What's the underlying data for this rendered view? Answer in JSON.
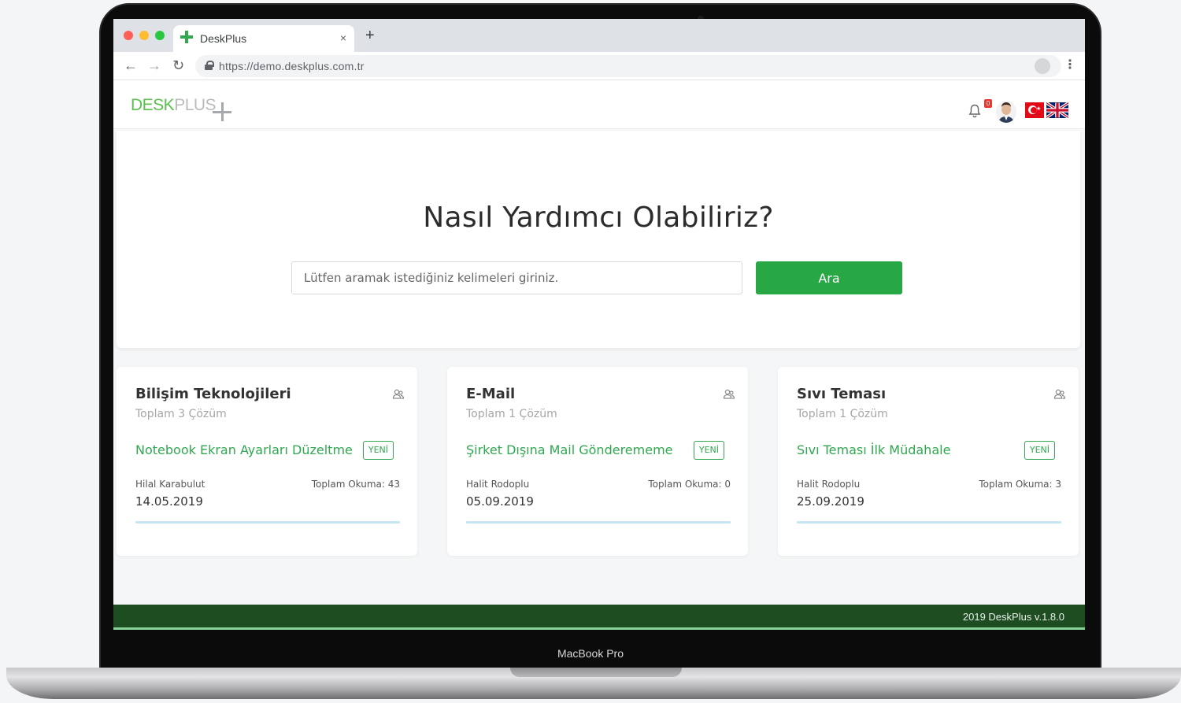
{
  "browser": {
    "tab_title": "DeskPlus",
    "tab_close": "×",
    "new_tab": "+",
    "url": "https://demo.deskplus.com.tr",
    "back_icon": "←",
    "forward_icon": "→",
    "reload_icon": "↻",
    "star_icon": "☆",
    "menu_icon": "⋮"
  },
  "header": {
    "logo_desk": "DESK",
    "logo_plus": "PLUS",
    "notification_count": "0",
    "languages": [
      "tr",
      "en"
    ]
  },
  "hero": {
    "title": "Nasıl Yardımcı Olabiliriz?",
    "search_placeholder": "Lütfen aramak istediğiniz kelimeleri giriniz.",
    "search_button": "Ara"
  },
  "cards": [
    {
      "title": "Bilişim Teknolojileri",
      "count": "Toplam 3 Çözüm",
      "link": "Notebook Ekran Ayarları Düzeltme",
      "badge": "YENİ",
      "author": "Hilal Karabulut",
      "reads": "Toplam Okuma: 43",
      "date": "14.05.2019",
      "icon": "users-icon"
    },
    {
      "title": "E-Mail",
      "count": "Toplam 1 Çözüm",
      "link": "Şirket Dışına Mail Gönderememe",
      "badge": "YENİ",
      "author": "Halit Rodoplu",
      "reads": "Toplam Okuma: 0",
      "date": "05.09.2019",
      "icon": "users-icon"
    },
    {
      "title": "Sıvı Teması",
      "count": "Toplam 1 Çözüm",
      "link": "Sıvı Teması İlk Müdahale",
      "badge": "YENİ",
      "author": "Halit Rodoplu",
      "reads": "Toplam Okuma: 3",
      "date": "25.09.2019",
      "icon": "users-icon"
    }
  ],
  "footer": {
    "text": "2019 DeskPlus v.1.8.0"
  },
  "device": {
    "label": "MacBook Pro"
  },
  "colors": {
    "accent_green": "#28a745",
    "link_green": "#2fa84f",
    "footer_green": "#1f4d22",
    "logo_green": "#5cc04e"
  }
}
